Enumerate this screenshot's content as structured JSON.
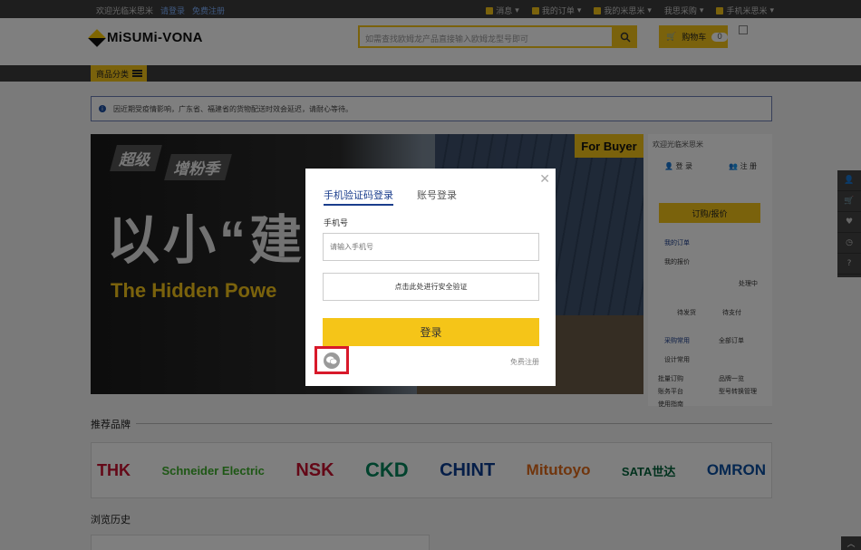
{
  "topbar": {
    "welcome": "欢迎光临米思米",
    "login": "请登录",
    "register": "免费注册",
    "right": [
      "消息",
      "我的订单",
      "我的米思米",
      "我思采购",
      "手机米思米"
    ]
  },
  "header": {
    "logo": "MiSUMi-VONA",
    "search_placeholder": "如需查找欧姆龙产品直接输入欧姆龙型号即可",
    "cart_label": "购物车",
    "cart_count": "0"
  },
  "nav": {
    "category_label": "商品分类"
  },
  "notice": {
    "text": "因近期受疫情影响，广东省、福建省的货物配送时效会延迟，请耐心等待。"
  },
  "banner": {
    "chip1": "超级",
    "chip2": "增粉季",
    "big_text": "以小“建",
    "sub_text": "The Hidden Powe",
    "for_buyer": "For Buyer"
  },
  "side": {
    "welcome": "欢迎光临米思米",
    "login": "登 录",
    "register": "注 册",
    "order_button": "订购/报价",
    "my_order": "我的订单",
    "my_quote": "我的报价",
    "processing": "处理中",
    "pending_ship": "待发货",
    "pending_pay": "待支付",
    "all_orders": "全部订单",
    "common_purchase": "采购常用",
    "design_common": "设计常用",
    "links": [
      "批量订购",
      "品牌一览",
      "账务平台",
      "型号转换管理",
      "使用指南"
    ]
  },
  "brands": {
    "title": "推荐品牌",
    "items": [
      {
        "name": "THK",
        "color": "#c8102e"
      },
      {
        "name": "Schneider Electric",
        "color": "#3dae2b"
      },
      {
        "name": "NSK",
        "color": "#c8102e"
      },
      {
        "name": "CKD",
        "color": "#00845a"
      },
      {
        "name": "CHINT",
        "color": "#0a3d91"
      },
      {
        "name": "Mitutoyo",
        "color": "#e06a1b"
      },
      {
        "name": "SATA世达",
        "color": "#00633a"
      },
      {
        "name": "OMRON",
        "color": "#0a4ea0"
      }
    ]
  },
  "history": {
    "title": "浏览历史"
  },
  "modal": {
    "tab_phone": "手机验证码登录",
    "tab_account": "账号登录",
    "phone_label": "手机号",
    "phone_placeholder": "请输入手机号",
    "verify_label": "点击此处进行安全验证",
    "login_label": "登录",
    "register_link": "免费注册"
  }
}
